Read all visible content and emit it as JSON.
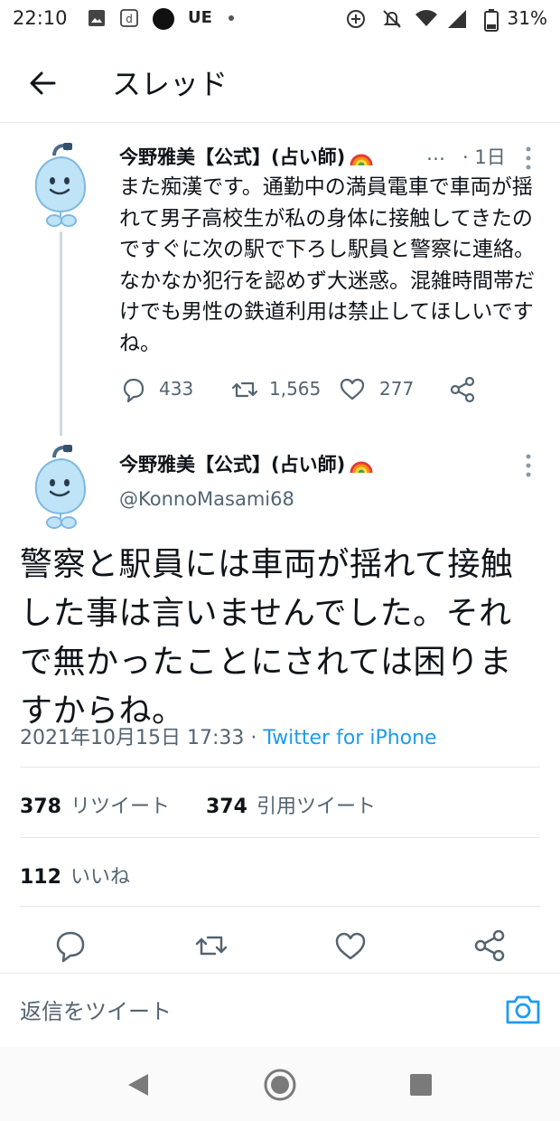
{
  "status_bar": {
    "time": "22:10",
    "carrier_text": "UE",
    "battery": "31%",
    "icons": [
      "image-icon",
      "docomo-d-icon",
      "black-dot-icon",
      "small-dot-icon",
      "data-saver-icon",
      "mute-icon",
      "wifi-icon",
      "signal-icon",
      "battery-icon"
    ]
  },
  "header": {
    "title": "スレッド",
    "back_icon": "back-arrow-icon"
  },
  "tweet1": {
    "name": "今野雅美【公式】(占い師)",
    "truncated": "…",
    "time": "· 1日",
    "body": "また痴漢です。通勤中の満員電車で車両が揺れて男子高校生が私の身体に接触してきたのですぐに次の駅で下ろし駅員と警察に連絡。なかなか犯行を認めず大迷惑。混雑時間帯だけでも男性の鉄道利用は禁止してほしいですね。",
    "replies": "433",
    "retweets": "1,565",
    "likes": "277"
  },
  "tweet2": {
    "name": "今野雅美【公式】(占い師)",
    "handle": "@KonnoMasami68",
    "body": "警察と駅員には車両が揺れて接触した事は言いませんでした。それで無かったことにされては困りますからね。",
    "date": "2021年10月15日 17:33 · ",
    "source": "Twitter for iPhone",
    "retweets_count": "378",
    "retweets_label": "リツイート",
    "quotes_count": "374",
    "quotes_label": "引用ツイート",
    "likes_count": "112",
    "likes_label": "いいね"
  },
  "reply_bar": {
    "placeholder": "返信をツイート"
  },
  "colors": {
    "accent": "#1d9bf0",
    "text": "#0f1419",
    "secondary": "#536471",
    "border": "#e6e8ea"
  }
}
